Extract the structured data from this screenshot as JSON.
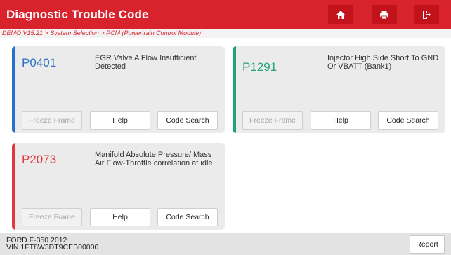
{
  "header": {
    "title": "Diagnostic Trouble Code",
    "buttons": [
      {
        "name": "home-button",
        "icon": "home-icon"
      },
      {
        "name": "print-button",
        "icon": "printer-icon"
      },
      {
        "name": "exit-button",
        "icon": "exit-icon"
      }
    ]
  },
  "breadcrumb": "DEMO V15.21 > System Selection > PCM (Powertrain Control Module)",
  "colors": {
    "accent": "#d9232c",
    "blue": "#2a6fc9",
    "green": "#23a27a",
    "red": "#e03a3f"
  },
  "cards": [
    {
      "code": "P0401",
      "description": "EGR Valve A Flow Insufficient Detected",
      "color": "#2a6fc9",
      "buttons": {
        "freeze": "Freeze Frame",
        "help": "Help",
        "search": "Code Search"
      }
    },
    {
      "code": "P1291",
      "description": "Injector High Side Short To GND Or VBATT (Bank1)",
      "color": "#23a27a",
      "buttons": {
        "freeze": "Freeze Frame",
        "help": "Help",
        "search": "Code Search"
      }
    },
    {
      "code": "P2073",
      "description": "Manifold Absolute Pressure/ Mass Air Flow-Throttle correlation at idle",
      "color": "#e03a3f",
      "buttons": {
        "freeze": "Freeze Frame",
        "help": "Help",
        "search": "Code Search"
      }
    }
  ],
  "footer": {
    "vehicle": "FORD F-350 2012",
    "vin": "VIN 1FT8W3DT9CEB00000",
    "report": "Report"
  }
}
